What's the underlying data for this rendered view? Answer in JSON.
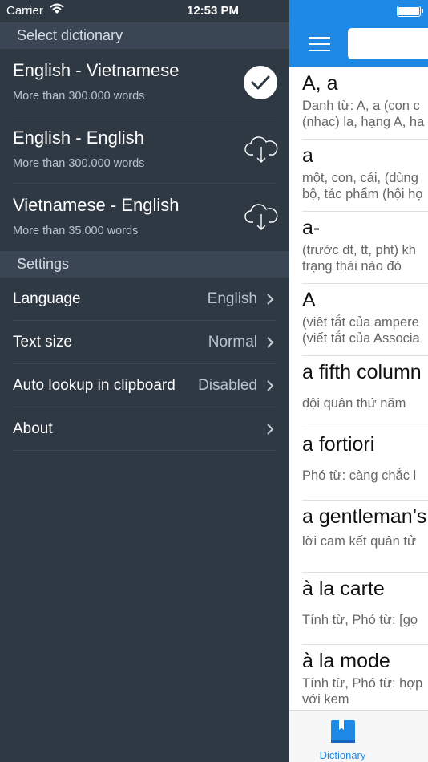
{
  "status_bar": {
    "carrier": "Carrier",
    "time": "12:53 PM"
  },
  "menu": {
    "dictionary_header": "Select dictionary",
    "dictionaries": [
      {
        "title": "English - Vietnamese",
        "subtitle": "More than 300.000 words",
        "state": "selected"
      },
      {
        "title": "English - English",
        "subtitle": "More than 300.000 words",
        "state": "download"
      },
      {
        "title": "Vietnamese - English",
        "subtitle": "More than 35.000 words",
        "state": "download"
      }
    ],
    "settings_header": "Settings",
    "settings": [
      {
        "label": "Language",
        "value": "English"
      },
      {
        "label": "Text size",
        "value": "Normal"
      },
      {
        "label": "Auto lookup in clipboard",
        "value": "Disabled"
      },
      {
        "label": "About",
        "value": ""
      }
    ]
  },
  "dictionary_panel": {
    "search": {
      "value": "",
      "placeholder": ""
    },
    "entries": [
      {
        "word": "A, a",
        "definition": "Danh từ: A, a (con c\n(nhạc) la, hạng A, ha"
      },
      {
        "word": "a",
        "definition": "một, con, cái, (dùng\nbộ, tác phẩm (hội họ"
      },
      {
        "word": "a-",
        "definition": "(trước dt, tt, pht) kh\ntrạng thái nào đó"
      },
      {
        "word": "A",
        "definition": "(viêt tắt của ampere\n(viết tắt của Associa"
      },
      {
        "word": "a fifth column",
        "definition": "đội quân thứ năm"
      },
      {
        "word": "a fortiori",
        "definition": "Phó từ: càng chắc l"
      },
      {
        "word": "a gentleman’s",
        "definition": "lời cam kết quân tử"
      },
      {
        "word": "à la carte",
        "definition": "Tính từ, Phó từ: [gọ"
      },
      {
        "word": "à la mode",
        "definition": "Tính từ, Phó từ: hợp\nvới kem"
      }
    ],
    "tab_label": "Dictionary"
  },
  "colors": {
    "menu_bg": "#2f3944",
    "header_bg": "#3a4654",
    "accent": "#1e88e5"
  },
  "icons": [
    "wifi-icon",
    "checkmark-icon",
    "cloud-download-icon",
    "chevron-right-icon",
    "hamburger-icon",
    "battery-icon",
    "book-icon"
  ]
}
